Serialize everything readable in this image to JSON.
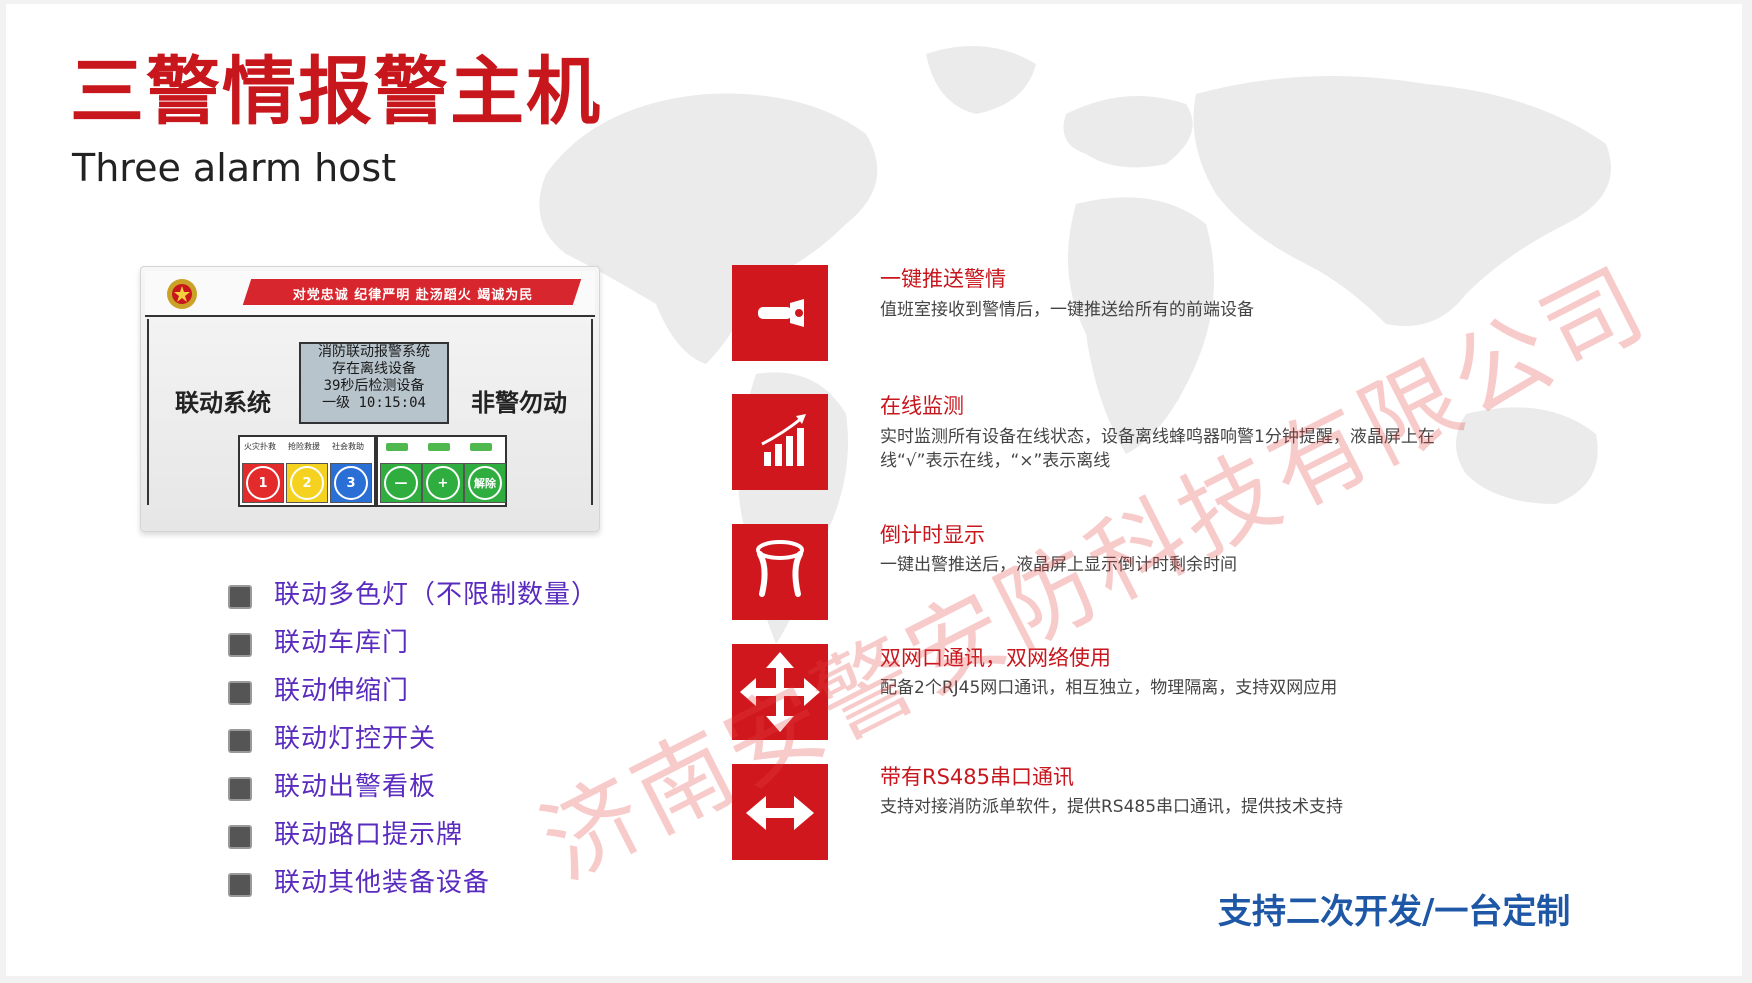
{
  "header": {
    "title_cn": "三警情报警主机",
    "title_en": "Three alarm host"
  },
  "device": {
    "slogan": "对党忠诚 纪律严明 赴汤蹈火 竭诚为民",
    "left_label": "联动系统",
    "right_label": "非警勿动",
    "lcd_lines": [
      "消防联动报警系统",
      "存在离线设备",
      "39秒后检测设备",
      "一级 10:15:04"
    ],
    "button_captions": [
      "火灾扑救",
      "抢险救援",
      "社会救助"
    ],
    "buttons": [
      "1",
      "2",
      "3",
      "—",
      "+",
      "解除"
    ]
  },
  "checklist": [
    "联动多色灯（不限制数量）",
    "联动车库门",
    "联动伸缩门",
    "联动灯控开关",
    "联动出警看板",
    "联动路口提示牌",
    "联动其他装备设备"
  ],
  "features": [
    {
      "icon": "flashlight-icon",
      "title": "一键推送警情",
      "desc": "值班室接收到警情后，一键推送给所有的前端设备"
    },
    {
      "icon": "signal-bars-icon",
      "title": "在线监测",
      "desc": "实时监测所有设备在线状态，设备离线蜂鸣器响警1分钟提醒，液晶屏上在线“√”表示在线，“×”表示离线"
    },
    {
      "icon": "hourglass-icon",
      "title": "倒计时显示",
      "desc": "一键出警推送后，液晶屏上显示倒计时剩余时间"
    },
    {
      "icon": "four-way-arrows-icon",
      "title": "双网口通讯，双网络使用",
      "desc": "配备2个RJ45网口通讯，相互独立，物理隔离，支持双网应用"
    },
    {
      "icon": "two-way-arrow-icon",
      "title": "带有RS485串口通讯",
      "desc": "支持对接消防派单软件，提供RS485串口通讯，提供技术支持"
    }
  ],
  "footer": {
    "support": "支持二次开发/一台定制"
  },
  "watermark": "济南安警安防科技有限公司",
  "colors": {
    "brand_red": "#c8161d",
    "icon_red": "#d0171d",
    "checklist_purple": "#5a2bbf",
    "support_blue": "#1d57a6"
  }
}
